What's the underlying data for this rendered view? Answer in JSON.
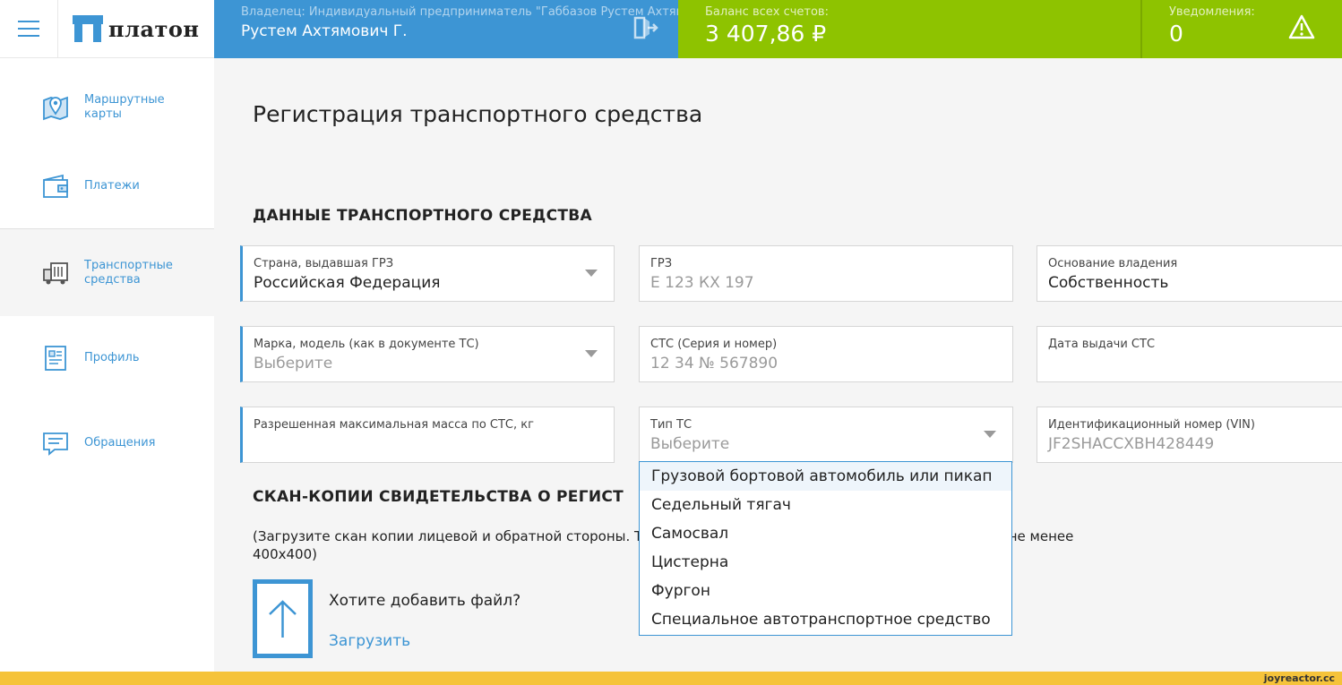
{
  "header": {
    "logo_text": "платон",
    "owner_label": "Владелец: Индивидуальный предприниматель \"Габбазов Рустем Ахтямо",
    "owner_name": "Рустем Ахтямович Г.",
    "balance_label": "Баланс всех счетов:",
    "balance_value": "3 407,86 ₽",
    "notifications_label": "Уведомления:",
    "notifications_value": "0"
  },
  "sidebar": {
    "items": [
      {
        "label": "Маршрутные карты",
        "icon": "map-pin-icon"
      },
      {
        "label": "Платежи",
        "icon": "wallet-icon"
      },
      {
        "label": "Транспортные средства",
        "icon": "truck-icon"
      },
      {
        "label": "Профиль",
        "icon": "profile-doc-icon"
      },
      {
        "label": "Обращения",
        "icon": "chat-icon"
      }
    ]
  },
  "main": {
    "title": "Регистрация транспортного средства",
    "section_vehicle": "ДАННЫЕ ТРАНСПОРТНОГО СРЕДСТВА",
    "fields": {
      "country": {
        "label": "Страна, выдавшая ГРЗ",
        "value": "Российская Федерация"
      },
      "grz": {
        "label": "ГРЗ",
        "placeholder": "Е 123 КХ 197"
      },
      "ownership": {
        "label": "Основание владения",
        "value": "Собственность"
      },
      "model": {
        "label": "Марка, модель (как в документе ТС)",
        "placeholder": "Выберите"
      },
      "sts": {
        "label": "СТС (Серия и номер)",
        "placeholder": "12 34 № 567890"
      },
      "sts_date": {
        "label": "Дата выдачи СТС",
        "value": ""
      },
      "mass": {
        "label": "Разрешенная максимальная масса по СТС, кг",
        "value": ""
      },
      "type": {
        "label": "Тип ТС",
        "placeholder": "Выберите"
      },
      "vin": {
        "label": "Идентификационный номер (VIN)",
        "placeholder": "JF2SHACCXBH428449"
      }
    },
    "type_options": [
      "Грузовой бортовой автомобиль или пикап",
      "Седельный тягач",
      "Самосвал",
      "Цистерна",
      "Фургон",
      "Специальное автотранспортное средство"
    ],
    "section_scan": "СКАН-КОПИИ СВИДЕТЕЛЬСТВА О РЕГИСТ",
    "scan_desc_start": "(Загрузите скан копии лицевой и обратной стороны. Т",
    "scan_desc_tail": "ие не менее",
    "scan_desc_line2": "400x400)",
    "upload_question": "Хотите добавить файл?",
    "upload_link": "Загрузить"
  },
  "footer": {
    "watermark": "joyreactor.cc"
  },
  "colors": {
    "accent_blue": "#3d95d4",
    "accent_green": "#8ec300",
    "footer_yellow": "#f5c33a"
  }
}
